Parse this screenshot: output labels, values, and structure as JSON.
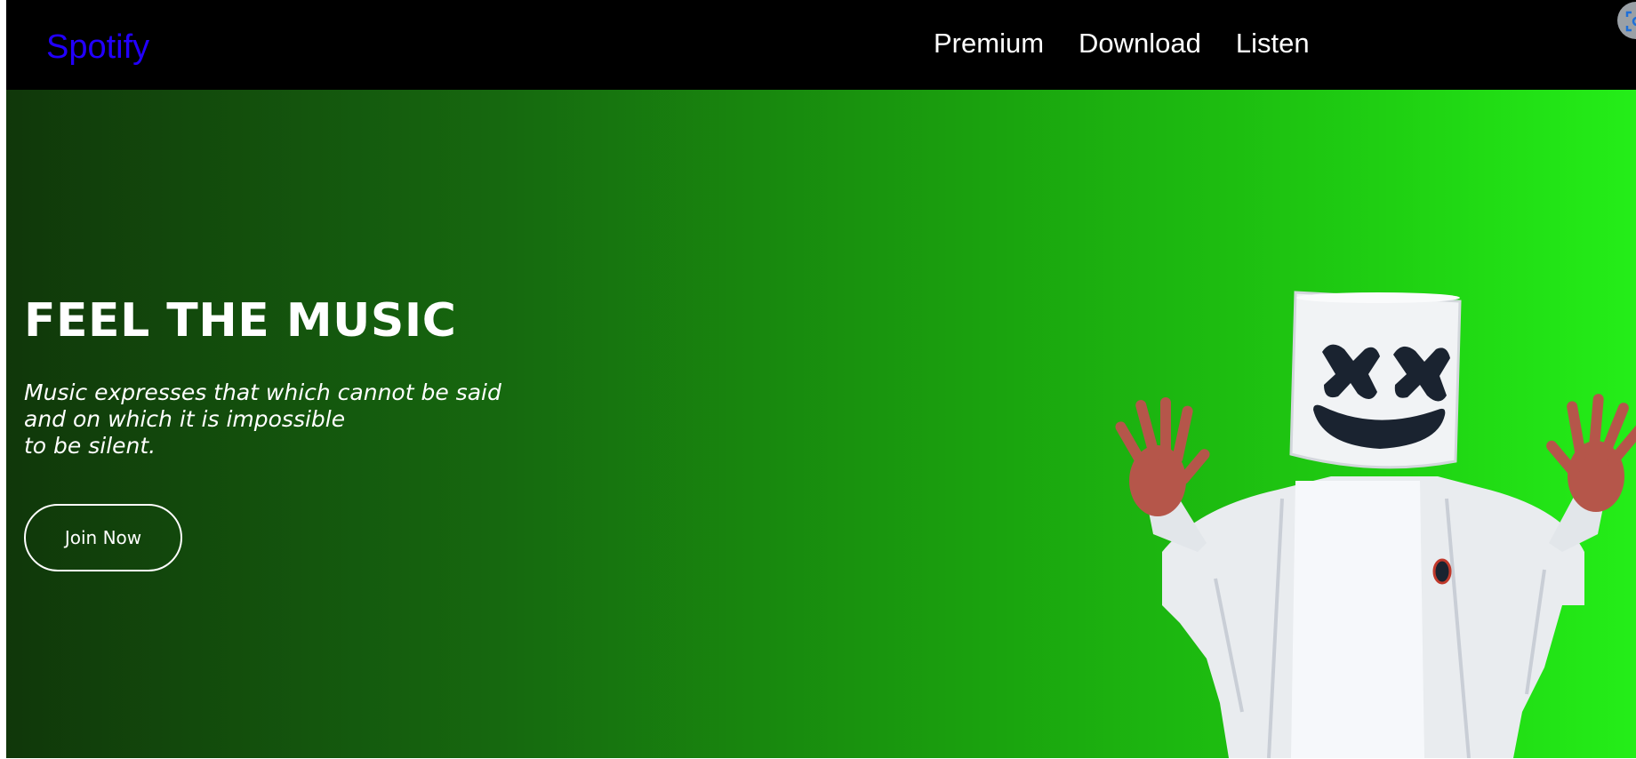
{
  "brand": {
    "name": "Spotify",
    "color": "#2200ff"
  },
  "nav": {
    "items": [
      {
        "label": "Premium"
      },
      {
        "label": "Download"
      },
      {
        "label": "Listen"
      }
    ]
  },
  "hero": {
    "headline": "FEEL THE MUSIC",
    "quote_lines": [
      "Music expresses that which cannot be said",
      "and on which it is impossible",
      "to be silent."
    ],
    "cta_label": "Join Now",
    "gradient_start": "#10370a",
    "gradient_end": "#24ee18",
    "image_icon": "masked-dj-figure"
  },
  "overlay": {
    "icon": "screenshot-capture-icon"
  }
}
